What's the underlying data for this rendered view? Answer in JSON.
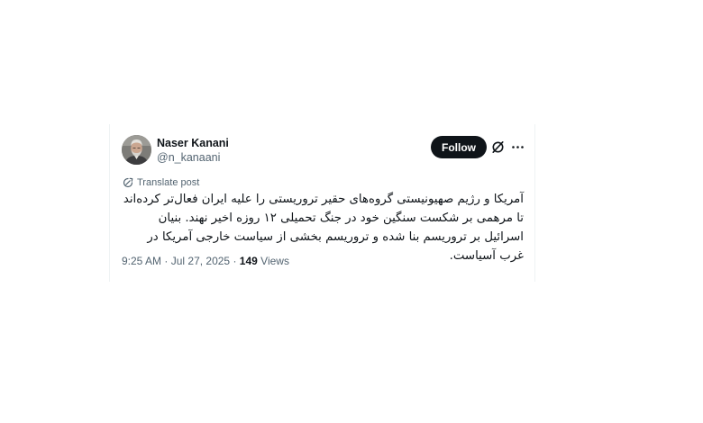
{
  "author": {
    "name": "Naser Kanani",
    "handle": "@n_kanaani"
  },
  "actions": {
    "follow_label": "Follow"
  },
  "icons": {
    "grok": "grok-icon",
    "more": "more-icon",
    "translate": "translate-icon"
  },
  "translate_label": "Translate post",
  "tweet_text": "آمریکا و رژیم صهیونیستی گروه‌های حقیر تروریستی را علیه ایران فعال‌تر کرده‌اند تا مرهمی بر شکست سنگین خود در جنگ تحمیلی ۱۲ روزه اخیر نهند. بنیان اسرائیل بر تروریسم بنا شده و تروریسم بخشی از سیاست خارجی آمریکا در غرب آسیاست.",
  "meta": {
    "time": "9:25 AM",
    "separator": "·",
    "date": "Jul 27, 2025",
    "views_count": "149",
    "views_label": "Views"
  },
  "colors": {
    "text_primary": "#0f1419",
    "text_secondary": "#536471",
    "border": "#eff3f4",
    "button_bg": "#0f1419",
    "button_text": "#ffffff"
  }
}
